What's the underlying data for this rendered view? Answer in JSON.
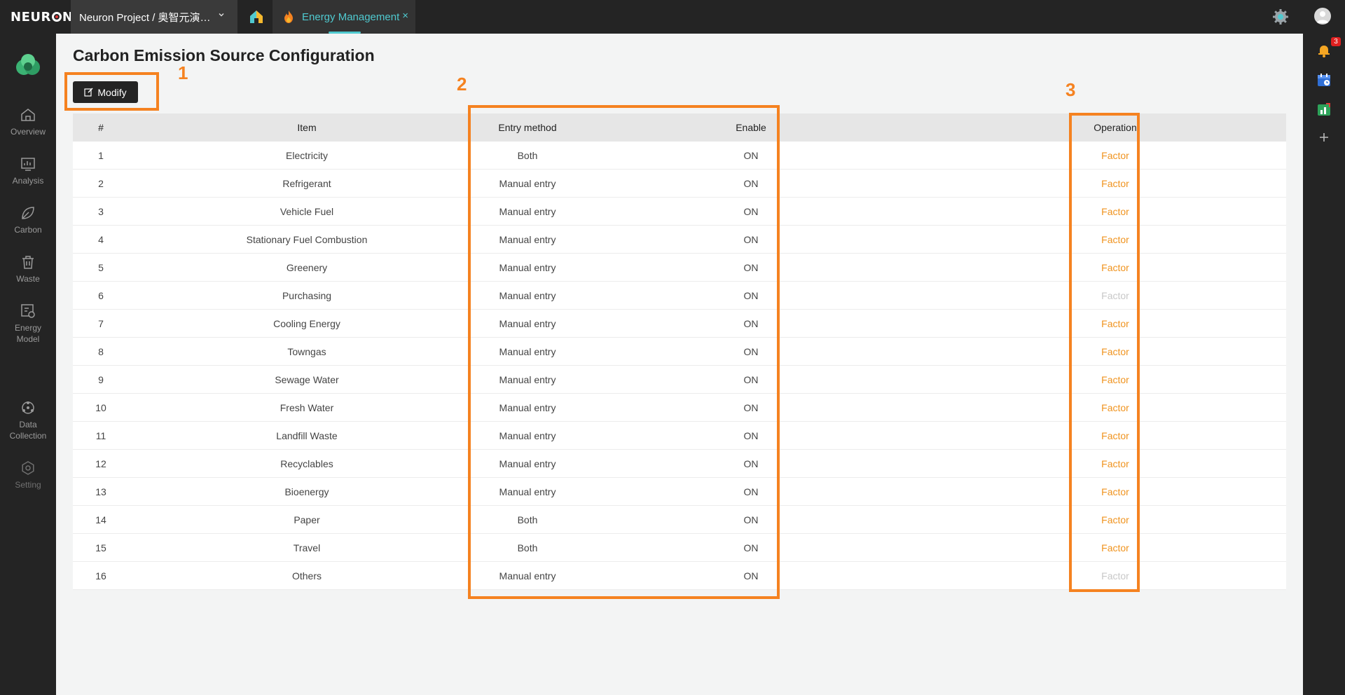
{
  "topbar": {
    "logo": {
      "pre": "NEUR",
      "post": "N"
    },
    "project_label": "Neuron Project / 奥智元演…",
    "energy_tab_label": "Energy Management",
    "energy_tab_close": "×",
    "colors": {
      "accent": "#4fc9cf",
      "bar": "#242424"
    }
  },
  "sidebar": {
    "items": [
      {
        "label": "Overview",
        "icon": "home-icon"
      },
      {
        "label": "Analysis",
        "icon": "chart-icon"
      },
      {
        "label": "Carbon",
        "icon": "leaf-icon"
      },
      {
        "label": "Waste",
        "icon": "trash-icon"
      },
      {
        "label_line1": "Energy",
        "label_line2": "Model",
        "icon": "model-icon"
      },
      {
        "label_line1": "Data",
        "label_line2": "Collection",
        "icon": "collection-icon"
      },
      {
        "label": "Setting",
        "icon": "setting-icon"
      }
    ]
  },
  "rightrail": {
    "notification_count": "3",
    "icons": [
      "bell-icon",
      "calendar-icon",
      "stats-icon",
      "plus-icon"
    ]
  },
  "page": {
    "title": "Carbon Emission Source Configuration",
    "modify_label": "Modify"
  },
  "table": {
    "headers": {
      "num": "#",
      "item": "Item",
      "entry": "Entry method",
      "enable": "Enable",
      "operation": "Operation"
    },
    "rows": [
      {
        "num": "1",
        "item": "Electricity",
        "entry": "Both",
        "enable": "ON",
        "op": "Factor",
        "op_enabled": true
      },
      {
        "num": "2",
        "item": "Refrigerant",
        "entry": "Manual entry",
        "enable": "ON",
        "op": "Factor",
        "op_enabled": true
      },
      {
        "num": "3",
        "item": "Vehicle Fuel",
        "entry": "Manual entry",
        "enable": "ON",
        "op": "Factor",
        "op_enabled": true
      },
      {
        "num": "4",
        "item": "Stationary Fuel Combustion",
        "entry": "Manual entry",
        "enable": "ON",
        "op": "Factor",
        "op_enabled": true
      },
      {
        "num": "5",
        "item": "Greenery",
        "entry": "Manual entry",
        "enable": "ON",
        "op": "Factor",
        "op_enabled": true
      },
      {
        "num": "6",
        "item": "Purchasing",
        "entry": "Manual entry",
        "enable": "ON",
        "op": "Factor",
        "op_enabled": false
      },
      {
        "num": "7",
        "item": "Cooling Energy",
        "entry": "Manual entry",
        "enable": "ON",
        "op": "Factor",
        "op_enabled": true
      },
      {
        "num": "8",
        "item": "Towngas",
        "entry": "Manual entry",
        "enable": "ON",
        "op": "Factor",
        "op_enabled": true
      },
      {
        "num": "9",
        "item": "Sewage Water",
        "entry": "Manual entry",
        "enable": "ON",
        "op": "Factor",
        "op_enabled": true
      },
      {
        "num": "10",
        "item": "Fresh Water",
        "entry": "Manual entry",
        "enable": "ON",
        "op": "Factor",
        "op_enabled": true
      },
      {
        "num": "11",
        "item": "Landfill Waste",
        "entry": "Manual entry",
        "enable": "ON",
        "op": "Factor",
        "op_enabled": true
      },
      {
        "num": "12",
        "item": "Recyclables",
        "entry": "Manual entry",
        "enable": "ON",
        "op": "Factor",
        "op_enabled": true
      },
      {
        "num": "13",
        "item": "Bioenergy",
        "entry": "Manual entry",
        "enable": "ON",
        "op": "Factor",
        "op_enabled": true
      },
      {
        "num": "14",
        "item": "Paper",
        "entry": "Both",
        "enable": "ON",
        "op": "Factor",
        "op_enabled": true
      },
      {
        "num": "15",
        "item": "Travel",
        "entry": "Both",
        "enable": "ON",
        "op": "Factor",
        "op_enabled": true
      },
      {
        "num": "16",
        "item": "Others",
        "entry": "Manual entry",
        "enable": "ON",
        "op": "Factor",
        "op_enabled": false
      }
    ]
  },
  "annotations": {
    "labels": [
      "1",
      "2",
      "3"
    ],
    "color": "#f58220"
  }
}
